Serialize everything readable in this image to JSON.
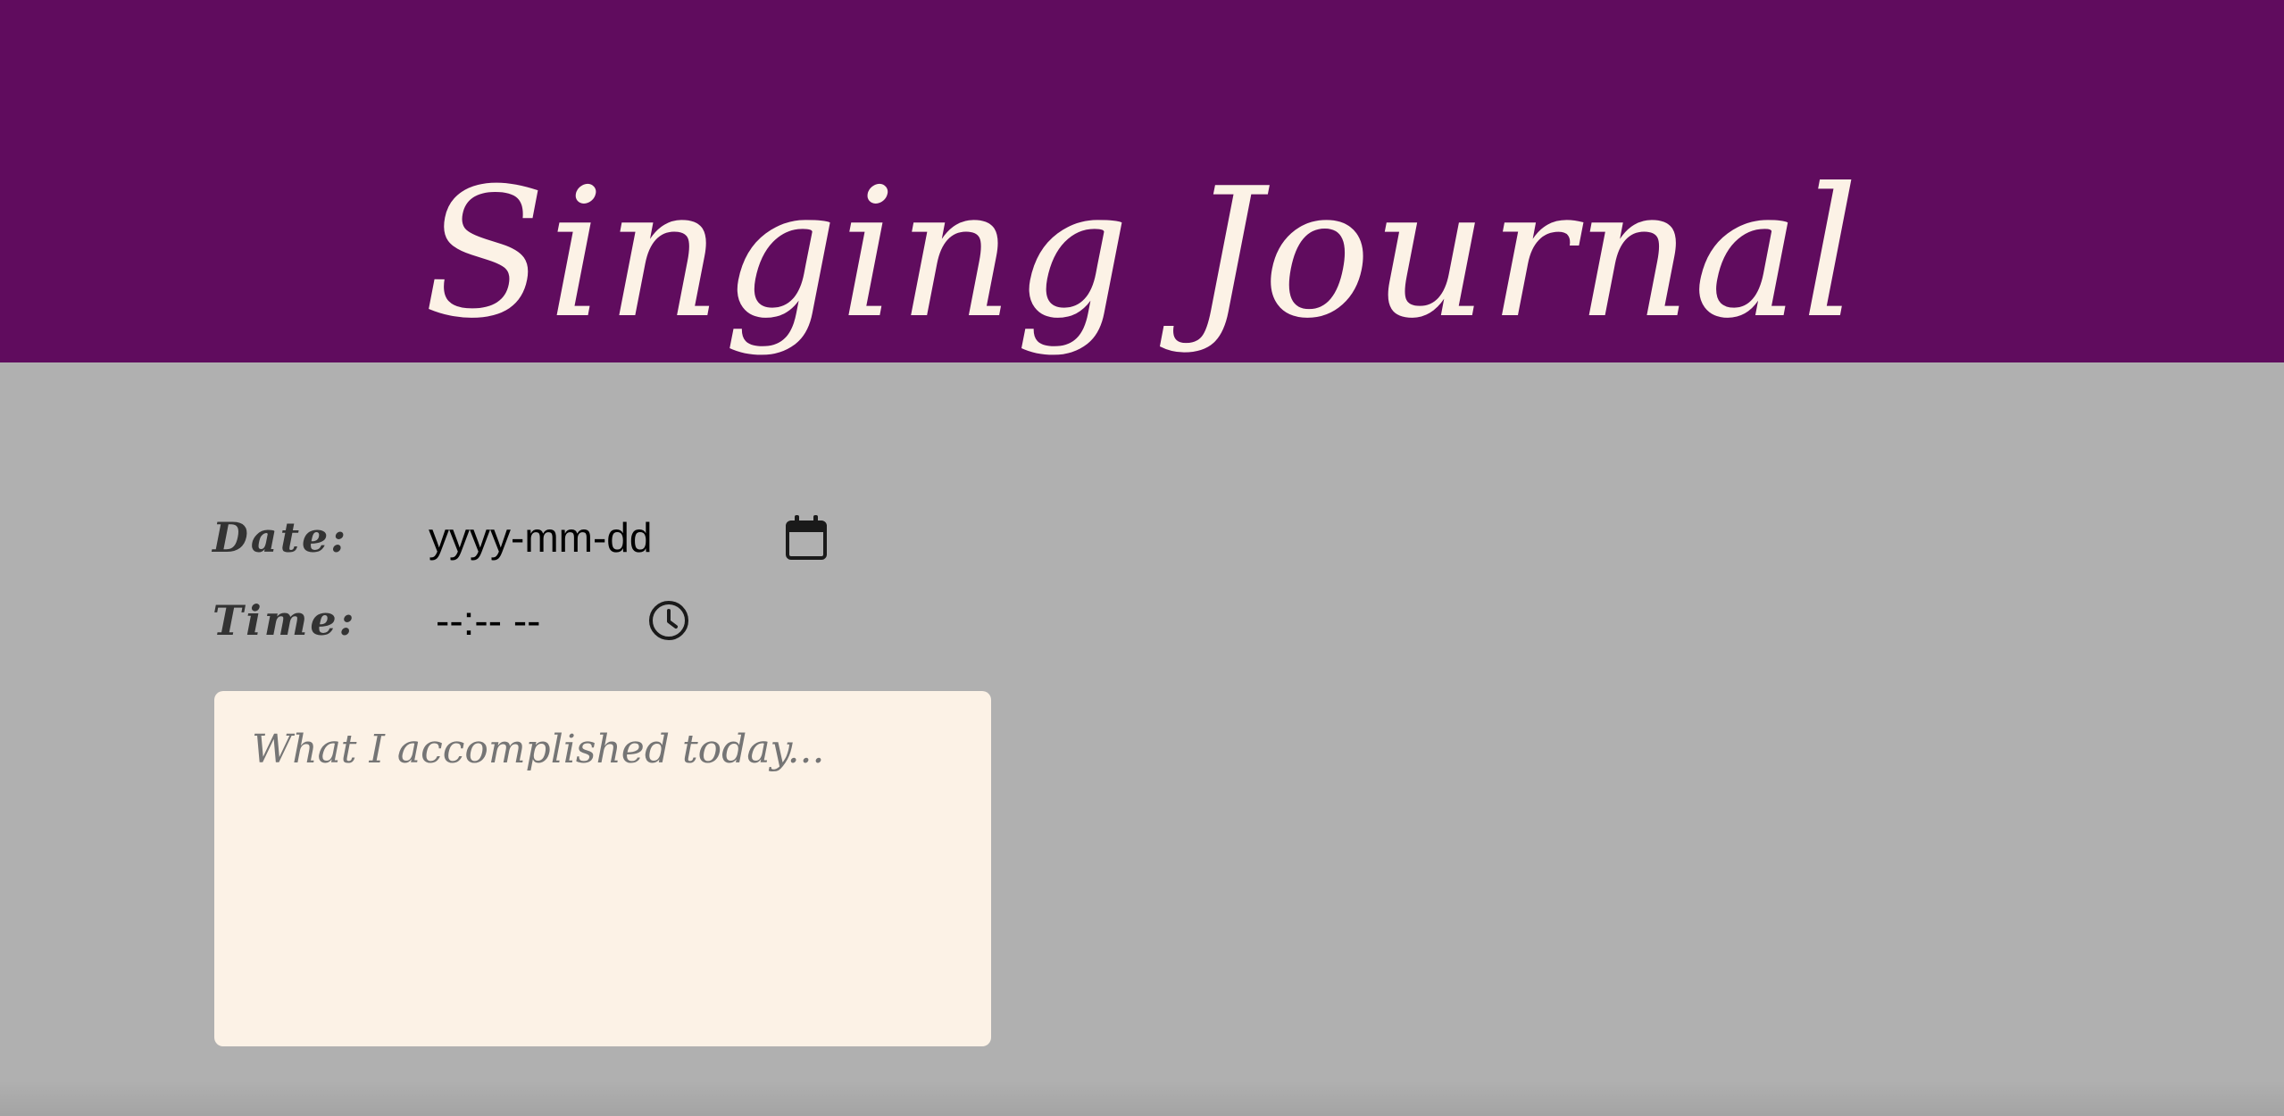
{
  "header": {
    "title": "Singing Journal",
    "background_color": "#600c5e",
    "title_color": "#fcf2e6"
  },
  "form": {
    "date": {
      "label": "Date:",
      "value": "yyyy-mm-dd",
      "icon": "calendar-icon"
    },
    "time": {
      "label": "Time:",
      "value": "--:-- --",
      "icon": "clock-icon"
    },
    "notes": {
      "placeholder": "What I accomplished today..."
    }
  },
  "colors": {
    "page_background": "#b0b0b0",
    "notes_background": "#fcf2e6",
    "label_text": "#333333"
  }
}
